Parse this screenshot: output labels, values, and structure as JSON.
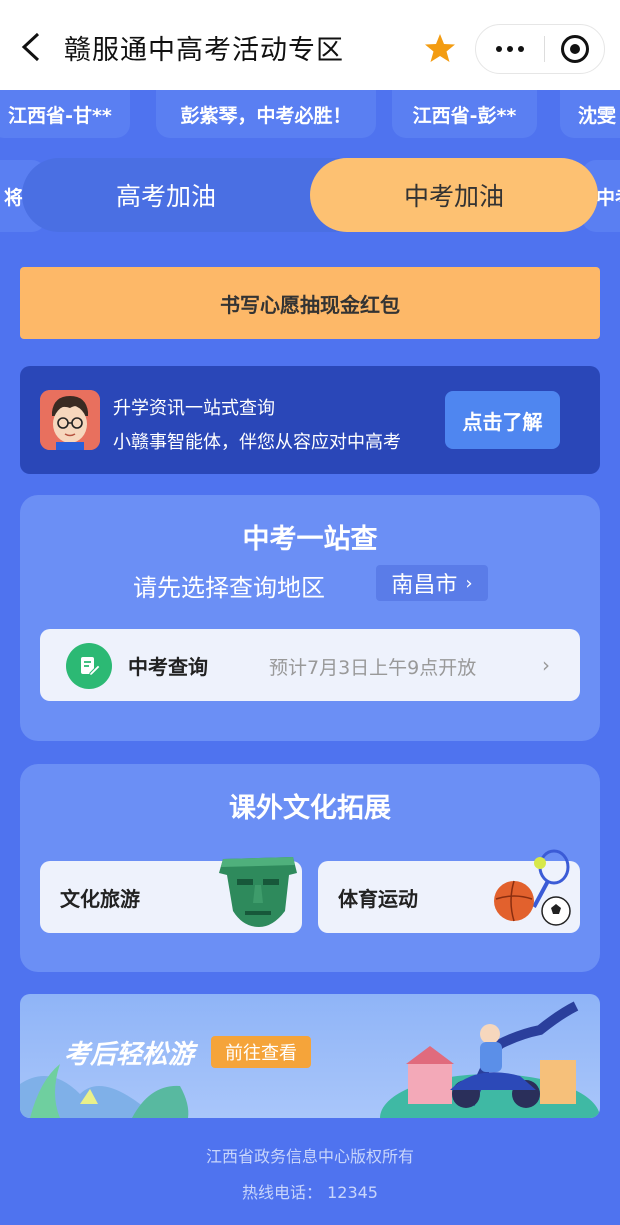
{
  "header": {
    "title": "赣服通中高考活动专区"
  },
  "marquee": {
    "row1": [
      "江西省-甘**",
      "彭紫琴，中考必胜！",
      "江西省-彭**",
      "沈雯"
    ],
    "row2_left": "将去",
    "row2_right": "中考"
  },
  "tabs": [
    {
      "label": "高考加油",
      "active": false
    },
    {
      "label": "中考加油",
      "active": true
    }
  ],
  "wish": {
    "label": "书写心愿抽现金红包"
  },
  "ai_banner": {
    "line1": "升学资讯一站式查询",
    "line2": "小赣事智能体，伴您从容应对中高考",
    "button": "点击了解"
  },
  "query_card": {
    "title": "中考一站查",
    "region_label": "请先选择查询地区",
    "region_value": "南昌市",
    "item_label": "中考查询",
    "item_note": "预计7月3日上午9点开放"
  },
  "culture_card": {
    "title": "课外文化拓展",
    "items": [
      "文化旅游",
      "体育运动"
    ]
  },
  "travel": {
    "title": "考后轻松游",
    "button": "前往查看"
  },
  "footer": {
    "copyright": "江西省政务信息中心版权所有",
    "hotline": "热线电话： 12345"
  },
  "colors": {
    "background": "#4f73ef",
    "tab_active": "#fdc172",
    "wish_button": "#fdb868",
    "ai_banner": "#2a47b8",
    "query_icon": "#2cb974",
    "travel_button": "#f5a43a"
  }
}
